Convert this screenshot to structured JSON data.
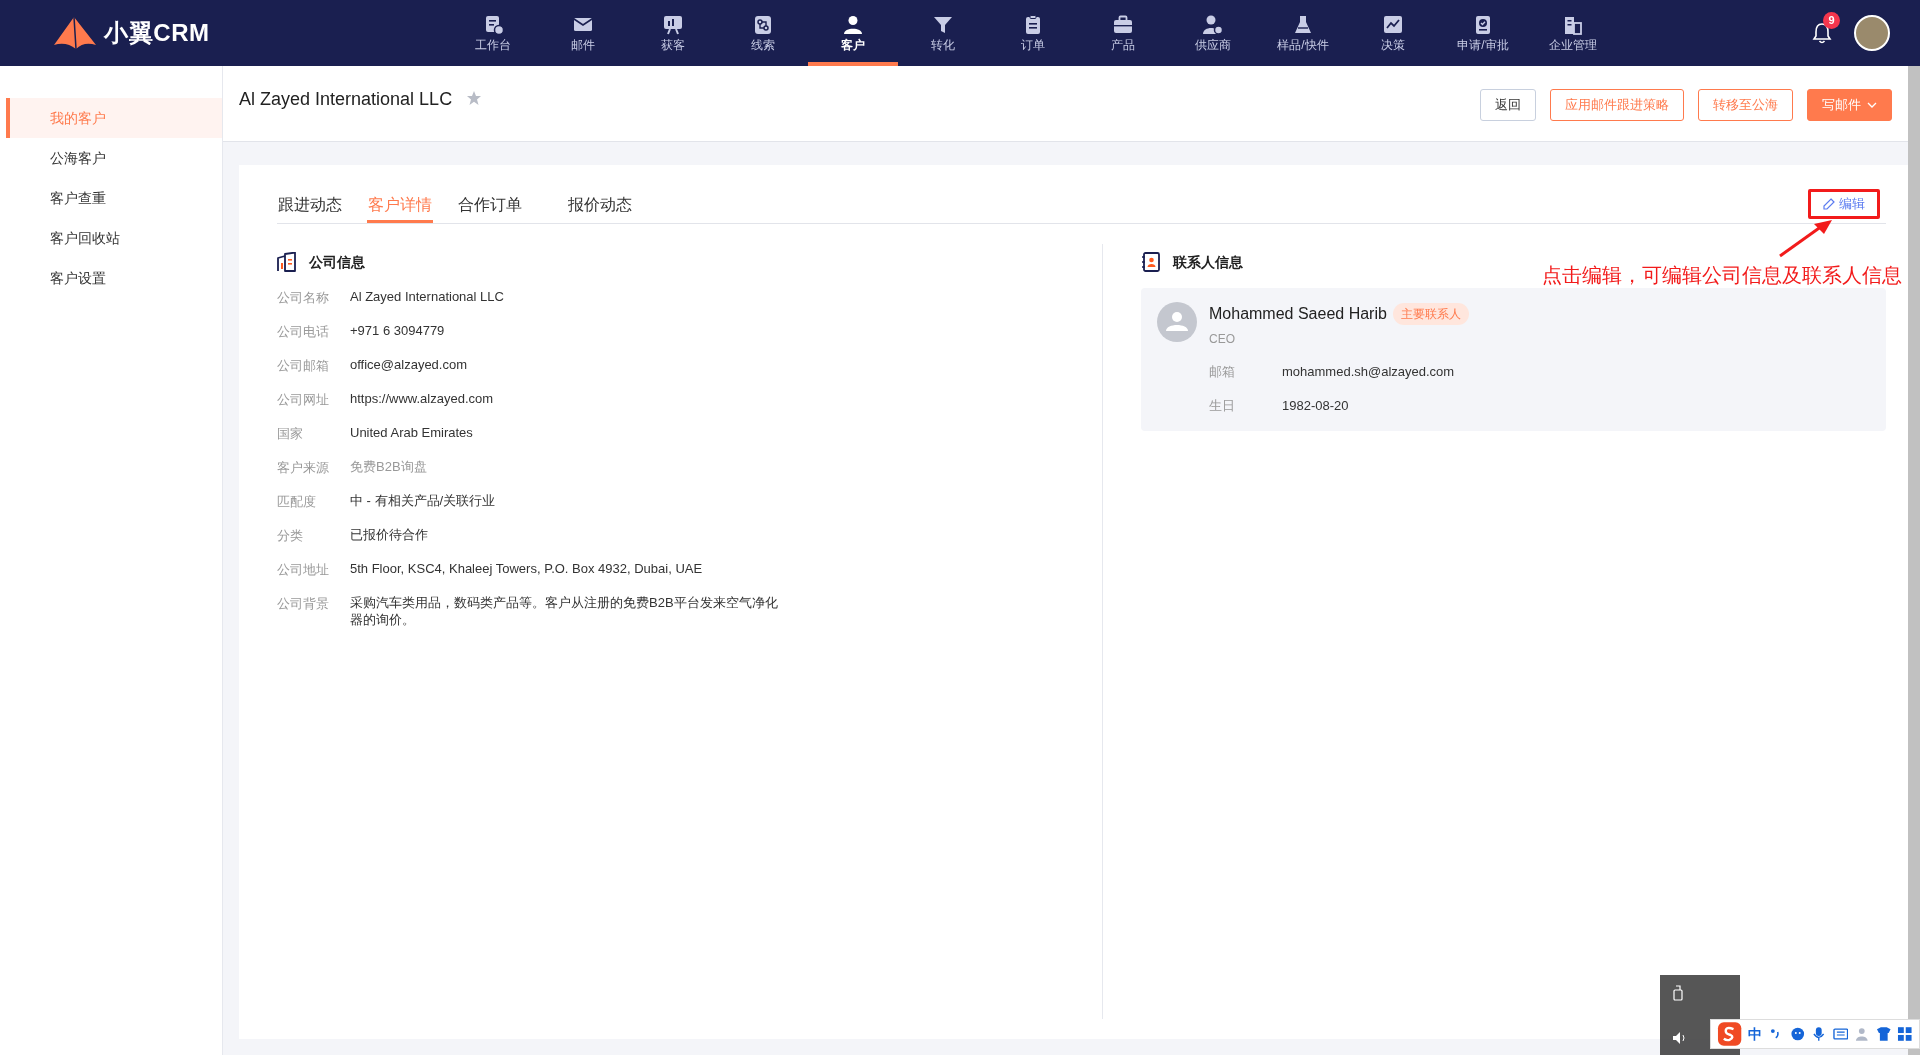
{
  "top_bar": {
    "logo_text": "小翼CRM",
    "nav": [
      {
        "label": "工作台",
        "selected": false
      },
      {
        "label": "邮件",
        "selected": false
      },
      {
        "label": "获客",
        "selected": false
      },
      {
        "label": "线索",
        "selected": false
      },
      {
        "label": "客户",
        "selected": true
      },
      {
        "label": "转化",
        "selected": false
      },
      {
        "label": "订单",
        "selected": false
      },
      {
        "label": "产品",
        "selected": false
      },
      {
        "label": "供应商",
        "selected": false
      },
      {
        "label": "样品/快件",
        "selected": false
      },
      {
        "label": "决策",
        "selected": false
      },
      {
        "label": "申请/审批",
        "selected": false
      },
      {
        "label": "企业管理",
        "selected": false
      }
    ],
    "notification_count": "9"
  },
  "sidebar": {
    "items": [
      {
        "label": "我的客户",
        "selected": true
      },
      {
        "label": "公海客户",
        "selected": false
      },
      {
        "label": "客户查重",
        "selected": false
      },
      {
        "label": "客户回收站",
        "selected": false
      },
      {
        "label": "客户设置",
        "selected": false
      }
    ]
  },
  "header": {
    "title": "Al Zayed International LLC",
    "starred": false,
    "buttons": [
      {
        "label": "返回",
        "kind": "plain"
      },
      {
        "label": "应用邮件跟进策略",
        "kind": "outline"
      },
      {
        "label": "转移至公海",
        "kind": "outline"
      },
      {
        "label": "写邮件",
        "kind": "primary"
      }
    ]
  },
  "tabs": [
    {
      "label": "跟进动态",
      "selected": false
    },
    {
      "label": "客户详情",
      "selected": true
    },
    {
      "label": "合作订单",
      "selected": false
    },
    {
      "label": "报价动态",
      "selected": false
    }
  ],
  "edit_button": {
    "label": "编辑"
  },
  "annotation": {
    "text": "点击编辑，可编辑公司信息及联系人信息"
  },
  "company_info": {
    "title": "公司信息",
    "fields": [
      {
        "label": "公司名称",
        "value": "Al Zayed International LLC",
        "muted": false
      },
      {
        "label": "公司电话",
        "value": "+971 6 3094779",
        "muted": false
      },
      {
        "label": "公司邮箱",
        "value": "office@alzayed.com",
        "muted": false
      },
      {
        "label": "公司网址",
        "value": "https://www.alzayed.com",
        "muted": false
      },
      {
        "label": "国家",
        "value": "United Arab Emirates",
        "muted": false
      },
      {
        "label": "客户来源",
        "value": "免费B2B询盘",
        "muted": true
      },
      {
        "label": "匹配度",
        "value": "中 - 有相关产品/关联行业",
        "muted": false
      },
      {
        "label": "分类",
        "value": "已报价待合作",
        "muted": false
      },
      {
        "label": "公司地址",
        "value": "5th Floor, KSC4, Khaleej Towers, P.O. Box 4932, Dubai, UAE",
        "muted": false
      },
      {
        "label": "公司背景",
        "value": "采购汽车类用品，数码类产品等。客户从注册的免费B2B平台发来空气净化器的询价。",
        "muted": false
      }
    ]
  },
  "contact_info": {
    "title": "联系人信息",
    "contacts": [
      {
        "name": "Mohammed Saeed Harib",
        "badge": "主要联系人",
        "role": "CEO",
        "fields": [
          {
            "label": "邮箱",
            "value": "mohammed.sh@alzayed.com"
          },
          {
            "label": "生日",
            "value": "1982-08-20"
          }
        ]
      }
    ]
  },
  "ime_toolbar": {
    "mode": "中"
  }
}
